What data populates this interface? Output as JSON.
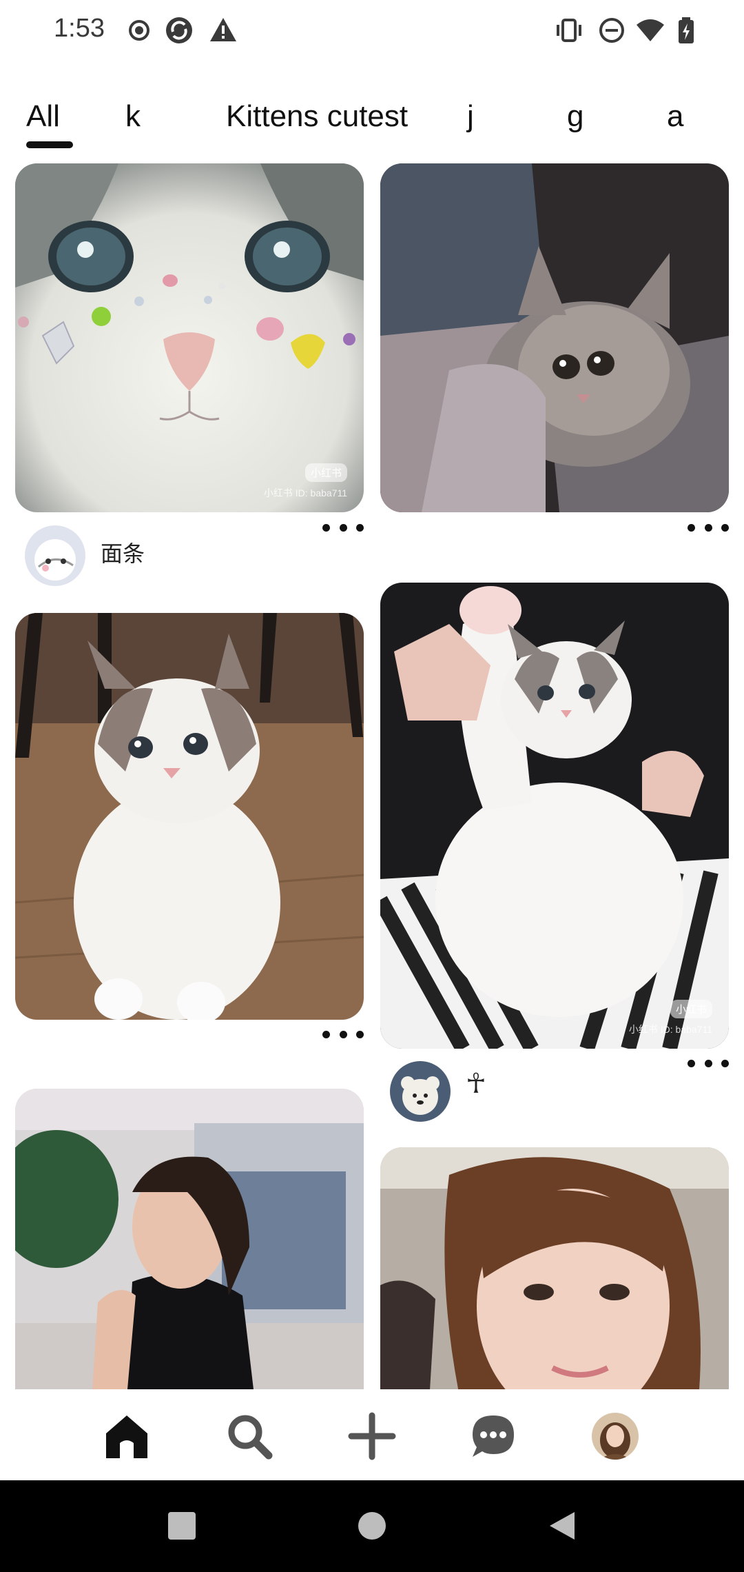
{
  "status_bar": {
    "time": "1:53",
    "left_icons": [
      "record-icon",
      "sync-icon",
      "warning-icon"
    ],
    "right_icons": [
      "vibrate-icon",
      "do-not-disturb-icon",
      "wifi-icon",
      "battery-icon"
    ]
  },
  "tabs": [
    {
      "label": "All",
      "selected": true
    },
    {
      "label": "k",
      "selected": false
    },
    {
      "label": "Kittens cutest",
      "selected": false
    },
    {
      "label": "j",
      "selected": false
    },
    {
      "label": "g",
      "selected": false
    },
    {
      "label": "a",
      "selected": false
    }
  ],
  "pins": [
    {
      "description": "white kitten face with gems",
      "watermark": "小红书 ID: baba711",
      "badge": "小红书",
      "author": "面条"
    },
    {
      "description": "grey fluffy kitten on lap"
    },
    {
      "description": "ragdoll cat on wooden floor"
    },
    {
      "description": "ragdoll cat held on lap",
      "watermark": "小红书 ID: baba711",
      "badge": "小红书",
      "author": "☥"
    },
    {
      "description": "woman in black dress"
    },
    {
      "description": "woman selfie"
    }
  ],
  "bottom_nav": {
    "items": [
      "home-icon",
      "search-icon",
      "create-icon",
      "messages-icon",
      "profile-avatar"
    ]
  },
  "system_nav": [
    "recents-button",
    "home-button",
    "back-button"
  ],
  "colors": {
    "accent": "#111111",
    "background": "#ffffff",
    "system_nav": "#000000"
  }
}
